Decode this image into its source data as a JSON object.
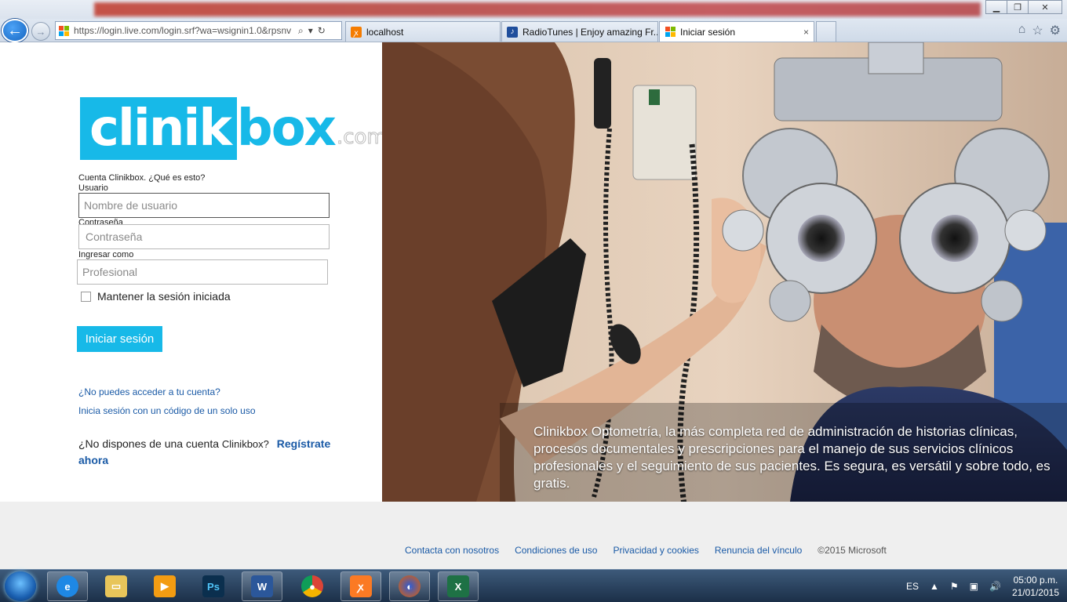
{
  "browser": {
    "address": "https://login.live.com/login.srf?wa=wsignin1.0&rpsnv",
    "address_host": "live.com",
    "tabs": [
      {
        "label": "localhost",
        "icon": "xampp-icon",
        "active": false
      },
      {
        "label": "RadioTunes | Enjoy amazing Fr...",
        "icon": "radiotunes-icon",
        "active": false
      },
      {
        "label": "Iniciar sesión",
        "icon": "microsoft-icon",
        "active": true
      }
    ],
    "close_tab": "×"
  },
  "logo": {
    "part1": "clinik",
    "part2": "box",
    "suffix": ".com"
  },
  "form": {
    "account_hint": "Cuenta Clinikbox. ¿Qué es esto?",
    "user_label": "Usuario",
    "user_placeholder": "Nombre de usuario",
    "password_label": "Contraseña",
    "password_placeholder": "Contraseña",
    "role_label": "Ingresar como",
    "role_placeholder": "Profesional",
    "keep_signed_in": "Mantener la sesión iniciada",
    "signin_button": "Iniciar sesión",
    "cant_access": "¿No puedes acceder a tu cuenta?",
    "one_time_code": "Inicia sesión con un código de un solo uso",
    "no_account_text": "¿No dispones de una cuenta",
    "no_account_brand": "Clinikbox?",
    "register": "Regístrate ahora"
  },
  "hero": {
    "text": "Clinikbox Optometría,  la más completa red de administración de historias clínicas, procesos documentales y prescripciones para el manejo de sus servicios clínicos profesionales y el seguimiento de sus pacientes. Es segura, es versátil y sobre todo, es gratis."
  },
  "footer": {
    "links": [
      "Contacta con nosotros",
      "Condiciones de uso",
      "Privacidad y cookies",
      "Renuncia del vínculo"
    ],
    "copyright": "©2015 Microsoft"
  },
  "taskbar": {
    "apps": [
      "internet-explorer",
      "file-explorer",
      "media-player",
      "photoshop",
      "word",
      "chrome",
      "xampp",
      "firefox",
      "excel"
    ],
    "language": "ES",
    "time": "05:00 p.m.",
    "date": "21/01/2015"
  },
  "colors": {
    "brand": "#17b9e8",
    "link": "#1a5aa6"
  }
}
